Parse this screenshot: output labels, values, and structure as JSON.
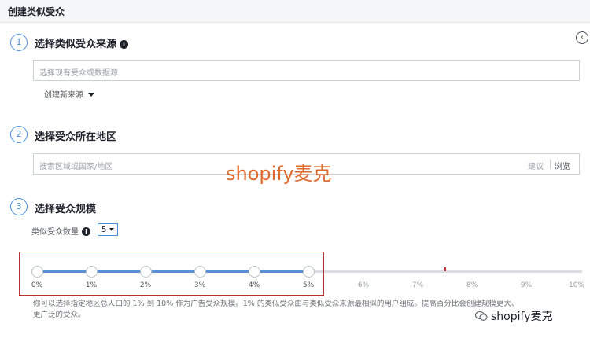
{
  "header": {
    "title": "创建类似受众"
  },
  "steps": [
    {
      "number": "1",
      "title": "选择类似受众来源"
    },
    {
      "number": "2",
      "title": "选择受众所在地区"
    },
    {
      "number": "3",
      "title": "选择受众规模"
    }
  ],
  "source": {
    "placeholder": "选择现有受众或数据源",
    "create_new": "创建新来源"
  },
  "location": {
    "placeholder": "搜索区域或国家/地区",
    "suggest": "建议",
    "browse": "浏览"
  },
  "size": {
    "count_label": "类似受众数量",
    "count_value": "5",
    "ticks": [
      "0%",
      "1%",
      "2%",
      "3%",
      "4%",
      "5%",
      "6%",
      "7%",
      "8%",
      "9%",
      "10%"
    ],
    "description_line1": "你可以选择指定地区总人口的 1% 到 10% 作为广告受众规模。1% 的类似受众由与类似受众来源最相似的用户组成。提高百分比会创建规模更大、",
    "description_line2": "更广泛的受众。"
  },
  "watermark": "shopify麦克",
  "wechat_watermark": "shopify麦克",
  "colors": {
    "accent": "#4a90d9",
    "highlight_box": "#c0302a",
    "watermark": "#e06a2e"
  }
}
